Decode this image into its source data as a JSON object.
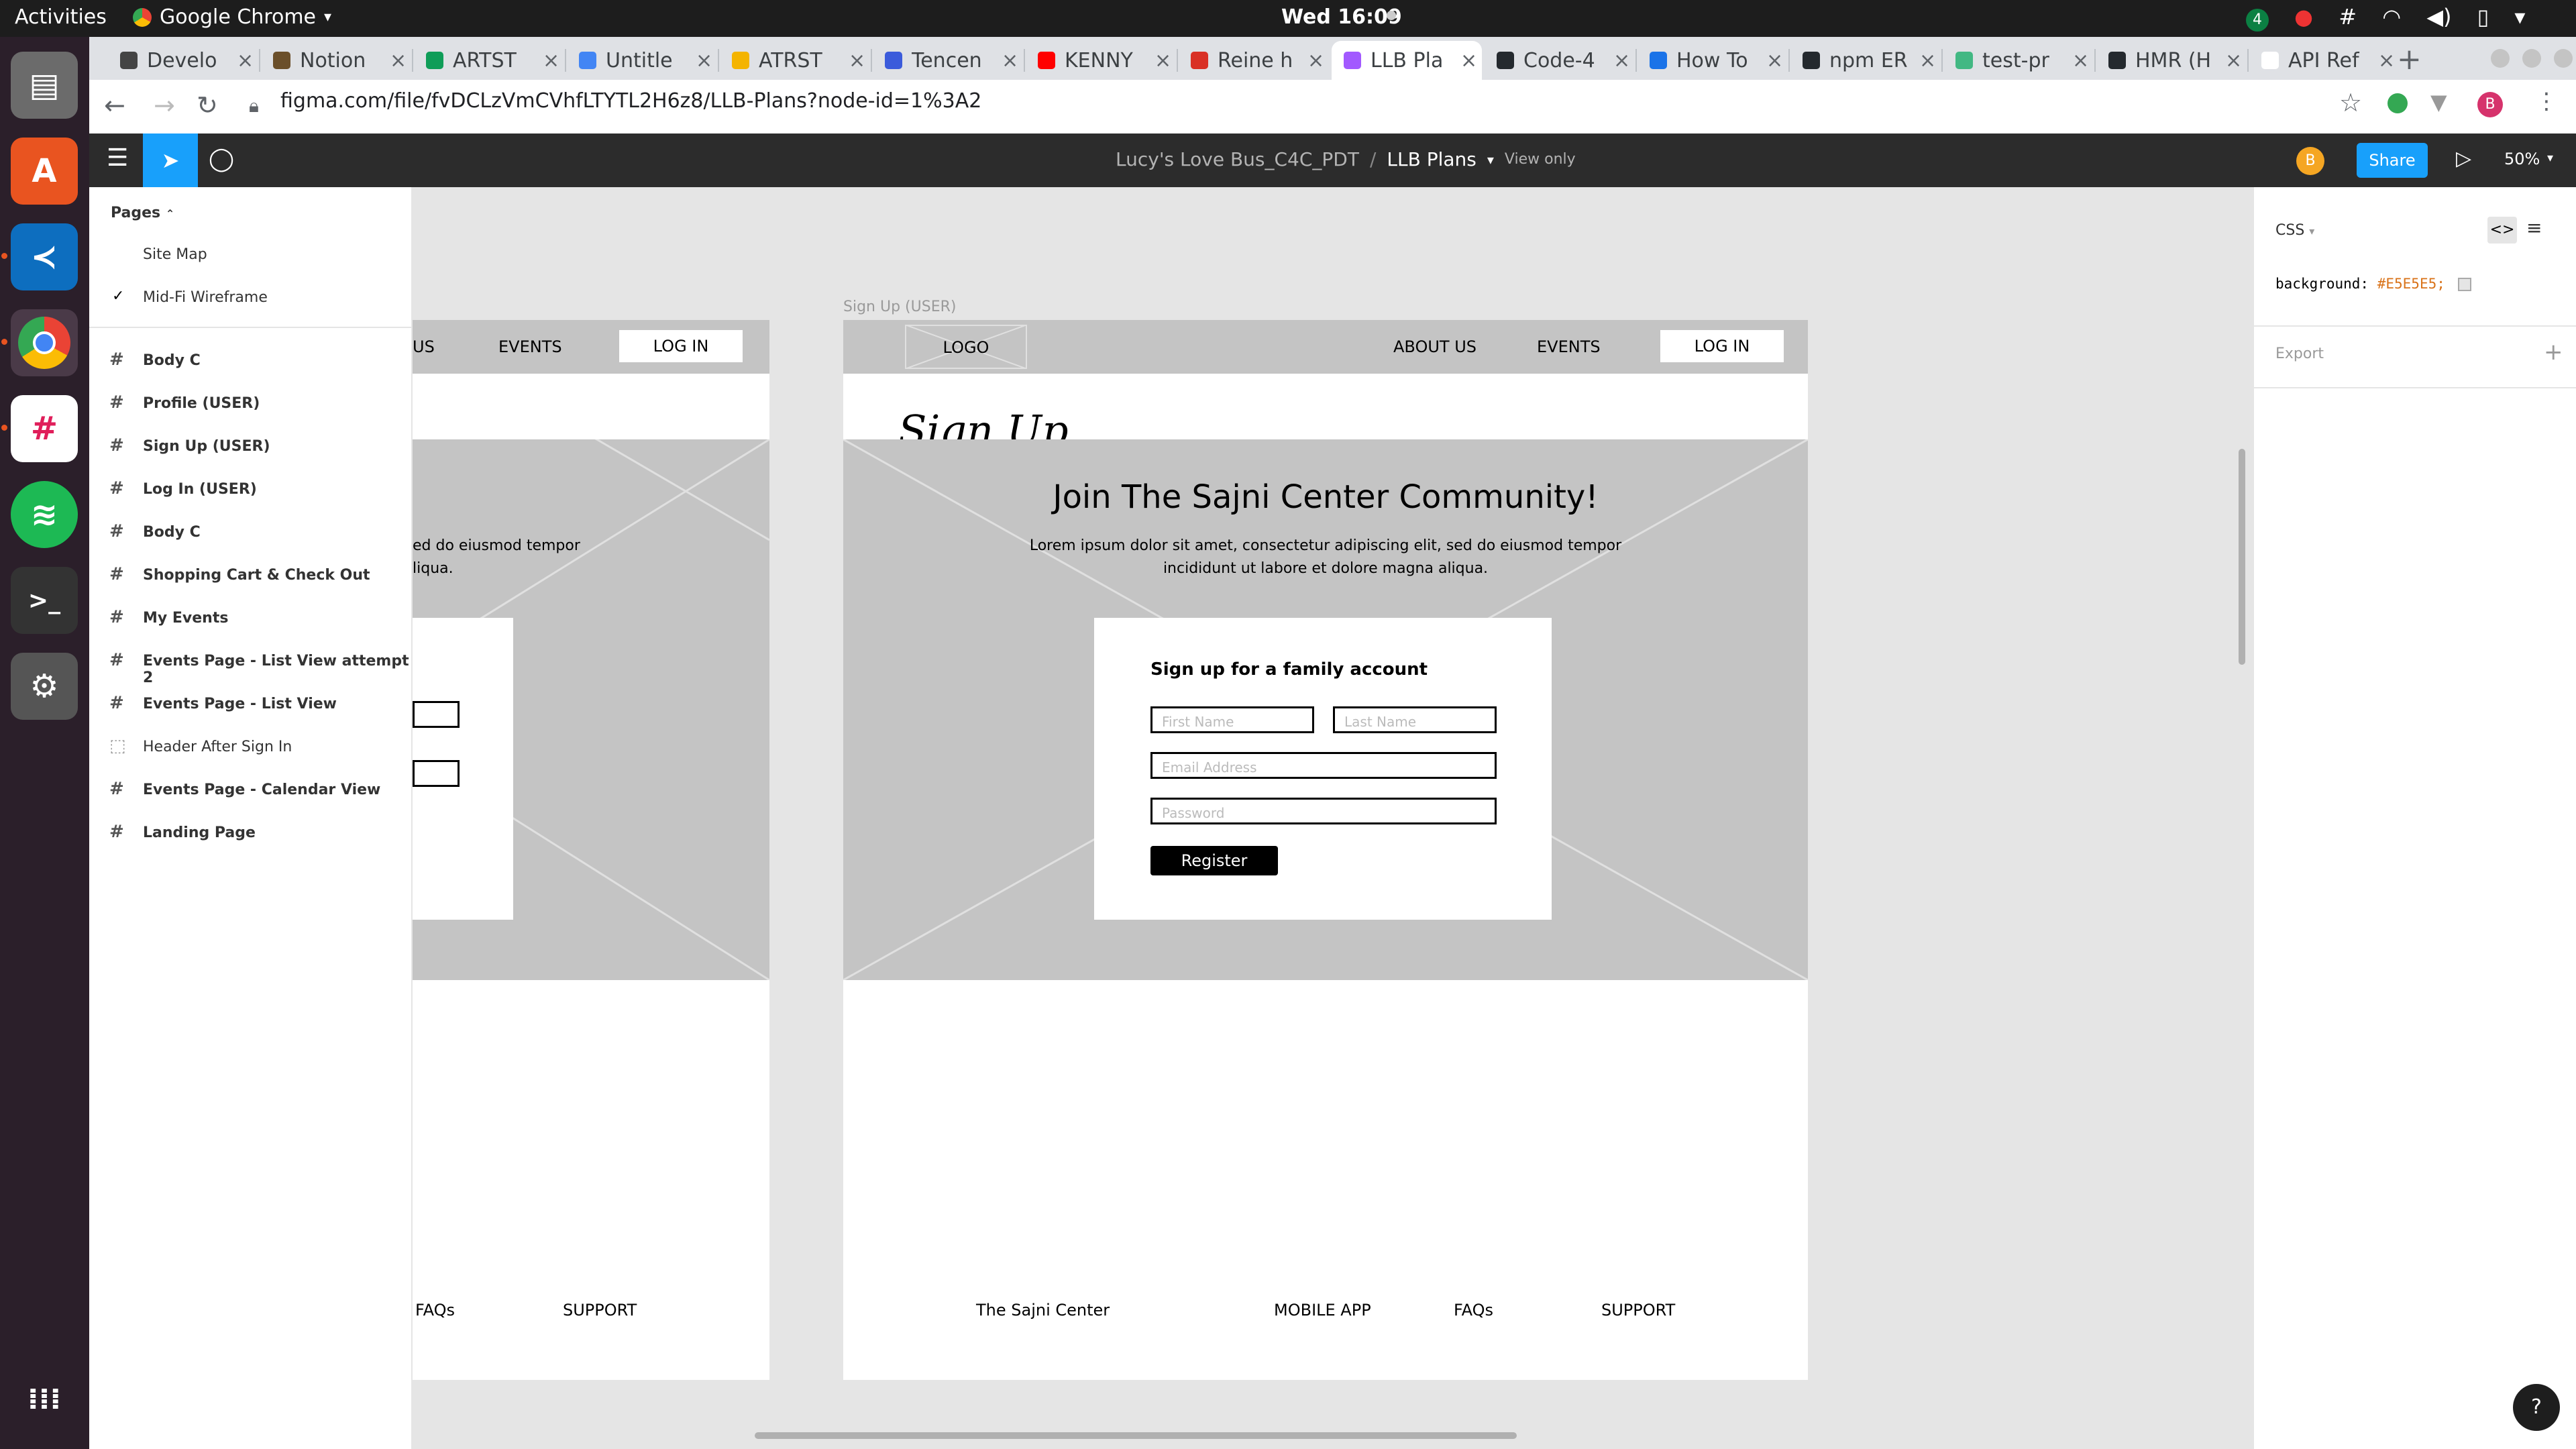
{
  "os": {
    "activities": "Activities",
    "app_name": "Google Chrome",
    "clock": "Wed 16:09",
    "notification_count": "4"
  },
  "browser": {
    "tabs": [
      {
        "title": "Develo",
        "color": "#444444"
      },
      {
        "title": "Notion",
        "color": "#6b4f2a"
      },
      {
        "title": "ARTST",
        "color": "#0f9d58"
      },
      {
        "title": "Untitle",
        "color": "#4285f4"
      },
      {
        "title": "ATRST",
        "color": "#f4b400"
      },
      {
        "title": "Tencen",
        "color": "#3b5bdb"
      },
      {
        "title": "KENNY",
        "color": "#ff0000"
      },
      {
        "title": "Reine h",
        "color": "#d93025"
      },
      {
        "title": "LLB Pla",
        "color": "#a259ff"
      },
      {
        "title": "Code-4",
        "color": "#24292e"
      },
      {
        "title": "How To",
        "color": "#1a73e8"
      },
      {
        "title": "npm ER",
        "color": "#24292e"
      },
      {
        "title": "test-pr",
        "color": "#42b883"
      },
      {
        "title": "HMR (H",
        "color": "#24292e"
      },
      {
        "title": "API Ref",
        "color": "#ffffff"
      }
    ],
    "active_tab_index": 8,
    "url": "figma.com/file/fvDCLzVmCVhfLTYTL2H6z8/LLB-Plans?node-id=1%3A2",
    "profile_letter": "B"
  },
  "figma": {
    "file_name": "Lucy's Love Bus_C4C_PDT",
    "separator": "/",
    "project_name": "LLB Plans",
    "mode": "View only",
    "avatar_letter": "B",
    "share_label": "Share",
    "zoom": "50%",
    "pages_header": "Pages",
    "pages": [
      "Site Map",
      "Mid-Fi Wireframe"
    ],
    "frames": [
      "Body C",
      "Profile (USER)",
      "Sign Up (USER)",
      "Log In (USER)",
      "Body C",
      "Shopping Cart & Check Out",
      "My Events",
      "Events Page - List View attempt 2",
      "Events Page - List View",
      "Header After Sign In",
      "Events Page - Calendar View",
      "Landing Page"
    ],
    "inspect": {
      "lang": "CSS",
      "property": "background:",
      "value": "#E5E5E5;",
      "export_label": "Export"
    },
    "help": "?"
  },
  "wireframe": {
    "frame_label": "Sign Up (USER)",
    "logo": "LOGO",
    "nav": [
      "ABOUT US",
      "EVENTS"
    ],
    "left_nav_partial": [
      "US",
      "EVENTS"
    ],
    "login": "LOG IN",
    "page_title": "Sign Up",
    "hero_title": "Join The Sajni Center Community!",
    "hero_text_1": "Lorem ipsum dolor sit amet, consectetur adipiscing elit, sed do eiusmod tempor",
    "hero_text_2": "incididunt ut labore et dolore magna aliqua.",
    "left_hero_text_1": "ed do eiusmod tempor",
    "left_hero_text_2": "liqua.",
    "form_title": "Sign up for a family account",
    "first_name": "First Name",
    "last_name": "Last Name",
    "email": "Email Address",
    "password": "Password",
    "register": "Register",
    "footer": [
      "The Sajni Center",
      "MOBILE APP",
      "FAQs",
      "SUPPORT"
    ],
    "left_footer": [
      "FAQs",
      "SUPPORT"
    ]
  }
}
